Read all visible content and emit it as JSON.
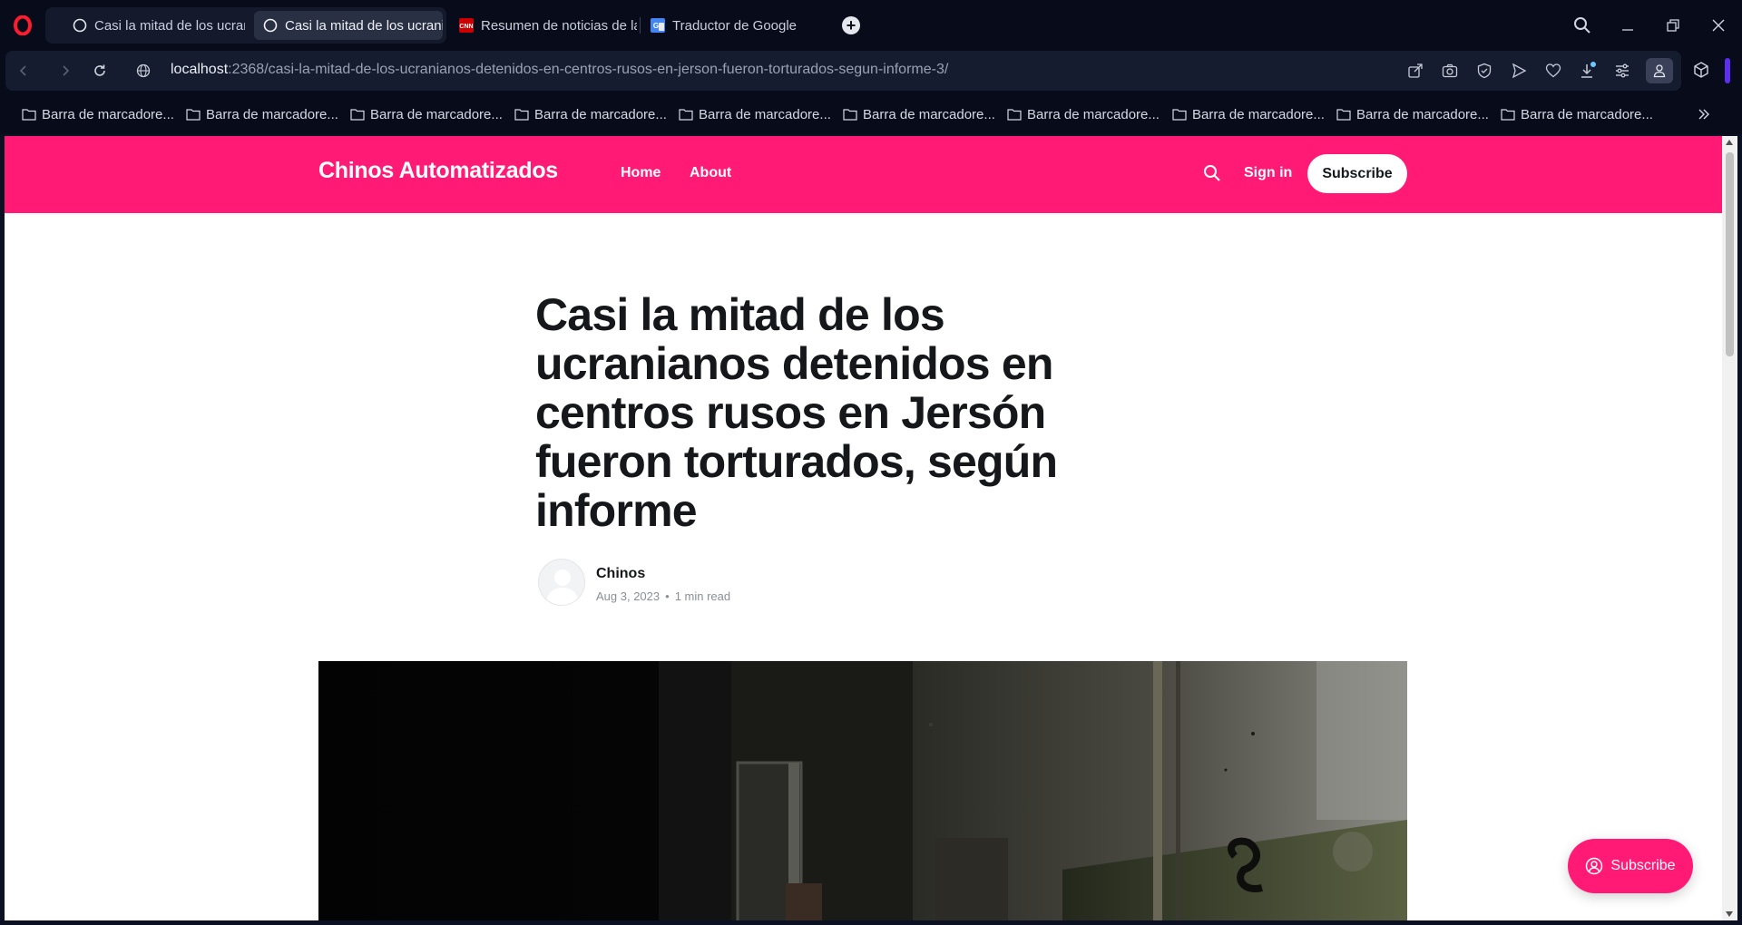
{
  "browser": {
    "tabs": [
      {
        "label": "Casi la mitad de los ucranianos detenidos",
        "icon": "ghost-icon"
      },
      {
        "label": "Casi la mitad de los ucranianos detenidos",
        "icon": "ghost-icon"
      },
      {
        "label": "Resumen de noticias de la guerra",
        "icon": "cnn-icon"
      },
      {
        "label": "Traductor de Google",
        "icon": "google-translate-icon"
      }
    ],
    "url_host": "localhost",
    "url_path": ":2368/casi-la-mitad-de-los-ucranianos-detenidos-en-centros-rusos-en-jerson-fueron-torturados-segun-informe-3/",
    "bookmarks": [
      "Barra de marcadore...",
      "Barra de marcadore...",
      "Barra de marcadore...",
      "Barra de marcadore...",
      "Barra de marcadore...",
      "Barra de marcadore...",
      "Barra de marcadore...",
      "Barra de marcadore...",
      "Barra de marcadore...",
      "Barra de marcadore..."
    ],
    "accent_color": "#5b2ef0"
  },
  "site": {
    "title": "Chinos Automatizados",
    "nav": [
      "Home",
      "About"
    ],
    "signin": "Sign in",
    "subscribe": "Subscribe",
    "brand_color": "#ff1a75"
  },
  "article": {
    "title": "Casi la mitad de los ucranianos detenidos en centros rusos en Jersón fueron torturados, según informe",
    "author": "Chinos",
    "date": "Aug 3, 2023",
    "read_time": "1 min read"
  },
  "portal": {
    "subscribe": "Subscribe"
  }
}
